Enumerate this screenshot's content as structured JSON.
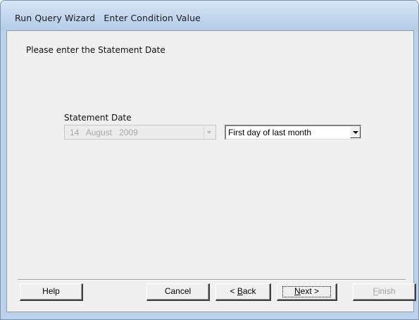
{
  "window": {
    "title": "Run Query Wizard   Enter Condition Value"
  },
  "main": {
    "prompt": "Please enter the Statement Date",
    "field_label": "Statement Date",
    "date_combo": {
      "day": "14",
      "month": "August",
      "year": "2009",
      "disabled": true
    },
    "period_combo": {
      "selected": "First day of last month"
    }
  },
  "buttons": {
    "help": "Help",
    "cancel": "Cancel",
    "back_prefix": "< ",
    "back_mnemonic": "B",
    "back_rest": "ack",
    "next_mnemonic": "N",
    "next_rest": "ext >",
    "finish_mnemonic": "F",
    "finish_rest": "inish"
  },
  "colors": {
    "frame": "#bcd1ea",
    "client": "#f0f0f0",
    "disabled_text": "#a8a8a8"
  }
}
